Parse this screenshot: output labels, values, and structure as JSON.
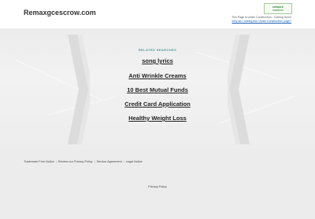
{
  "header": {
    "site_title": "Remaxgcescrow.com",
    "logo_top": "network",
    "logo_bottom": "solutions",
    "uc_line1": "This Page Is Under Construction - Coming Soon!",
    "uc_line2": "Why am I seeing this 'Under Construction' page?"
  },
  "main": {
    "related_title": "RELATED SEARCHES",
    "links": [
      "song lyrics",
      "Anti Wrinkle Creams",
      "10 Best Mutual Funds",
      "Credit Card Application",
      "Healthy Weight Loss"
    ]
  },
  "footer": {
    "links": [
      "Trademark Free Notice",
      "Review our Privacy Policy",
      "Service Agreement",
      "Legal Notice"
    ],
    "privacy": "Privacy Policy"
  }
}
